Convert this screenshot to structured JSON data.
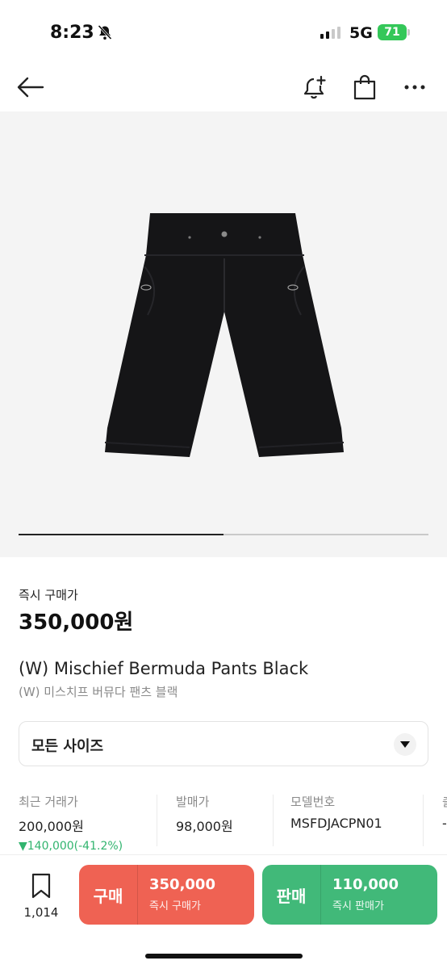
{
  "status_bar": {
    "time": "8:23",
    "network": "5G",
    "battery": "71"
  },
  "nav": {
    "back_icon": "arrow-left-icon",
    "icons": [
      "bell-plus-icon",
      "shopping-bag-icon",
      "more-horizontal-icon"
    ]
  },
  "gallery": {
    "image": "black bermuda shorts",
    "progress": 0.5
  },
  "product": {
    "price_label": "즉시 구매가",
    "price": "350,000원",
    "title_en": "(W) Mischief Bermuda Pants Black",
    "title_ko": "(W) 미스치프 버뮤다 팬츠 블랙"
  },
  "size_select": {
    "selected": "모든 사이즈"
  },
  "stats": [
    {
      "label": "최근 거래가",
      "value": "200,000원",
      "change": "▼140,000(-41.2%)"
    },
    {
      "label": "발매가",
      "value": "98,000원"
    },
    {
      "label": "모델번호",
      "value": "MSFDJACPN01"
    },
    {
      "label": "출",
      "value": "-"
    }
  ],
  "bottom": {
    "wish_count": "1,014",
    "buy": {
      "label": "구매",
      "price": "350,000",
      "sub": "즉시 구매가"
    },
    "sell": {
      "label": "판매",
      "price": "110,000",
      "sub": "즉시 판매가"
    }
  },
  "colors": {
    "buy": "#ef6253",
    "sell": "#41b979",
    "down": "#31b46e"
  }
}
